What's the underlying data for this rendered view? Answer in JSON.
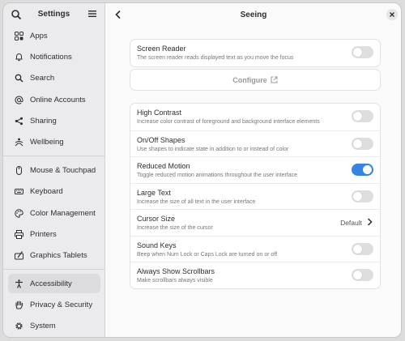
{
  "sidebar": {
    "title": "Settings",
    "items": [
      {
        "label": "Apps",
        "icon": "apps-icon"
      },
      {
        "label": "Notifications",
        "icon": "bell-icon"
      },
      {
        "label": "Search",
        "icon": "search-icon"
      },
      {
        "label": "Online Accounts",
        "icon": "at-icon"
      },
      {
        "label": "Sharing",
        "icon": "share-icon"
      },
      {
        "label": "Wellbeing",
        "icon": "wellbeing-icon"
      },
      {
        "label": "Mouse & Touchpad",
        "icon": "mouse-icon"
      },
      {
        "label": "Keyboard",
        "icon": "keyboard-icon"
      },
      {
        "label": "Color Management",
        "icon": "palette-icon"
      },
      {
        "label": "Printers",
        "icon": "printer-icon"
      },
      {
        "label": "Graphics Tablets",
        "icon": "tablet-icon"
      },
      {
        "label": "Accessibility",
        "icon": "accessibility-icon"
      },
      {
        "label": "Privacy & Security",
        "icon": "hand-icon"
      },
      {
        "label": "System",
        "icon": "gear-icon"
      }
    ],
    "active_item": "Accessibility"
  },
  "main": {
    "title": "Seeing",
    "screen_reader": {
      "title": "Screen Reader",
      "subtitle": "The screen reader reads displayed text as you move the focus",
      "enabled": false
    },
    "configure_label": "Configure",
    "options": [
      {
        "title": "High Contrast",
        "subtitle": "Increase color contrast of foreground and background interface elements",
        "enabled": false
      },
      {
        "title": "On/Off Shapes",
        "subtitle": "Use shapes to indicate state in addition to or instead of color",
        "enabled": false
      },
      {
        "title": "Reduced Motion",
        "subtitle": "Toggle reduced motion animations throughout the user interface",
        "enabled": true
      },
      {
        "title": "Large Text",
        "subtitle": "Increase the size of all text in the user interface",
        "enabled": false
      },
      {
        "title": "Cursor Size",
        "subtitle": "Increase the size of the cursor",
        "value": "Default"
      },
      {
        "title": "Sound Keys",
        "subtitle": "Beep when Num Lock or Caps Lock are turned on or off",
        "enabled": false
      },
      {
        "title": "Always Show Scrollbars",
        "subtitle": "Make scrollbars always visible",
        "enabled": false
      }
    ]
  },
  "colors": {
    "accent": "#3584e4",
    "sidebar_bg": "#ebebed",
    "active_bg": "#dcdcde"
  }
}
